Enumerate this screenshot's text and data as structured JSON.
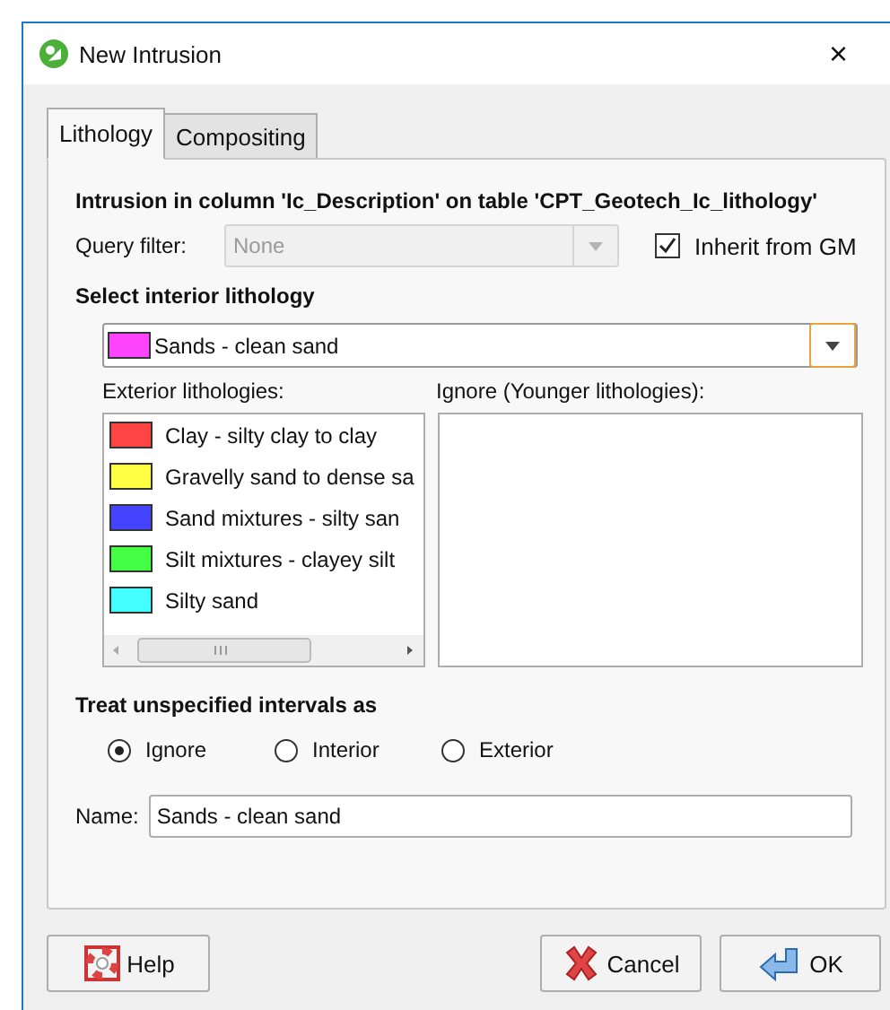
{
  "window": {
    "title": "New Intrusion",
    "close": "×"
  },
  "tabs": [
    {
      "label": "Lithology",
      "selected": true
    },
    {
      "label": "Compositing",
      "selected": false
    }
  ],
  "heading": "Intrusion in column 'Ic_Description' on table 'CPT_Geotech_Ic_lithology'",
  "query_filter": {
    "label": "Query filter:",
    "value": "None",
    "disabled": true
  },
  "inherit": {
    "label": "Inherit from GM",
    "checked": true
  },
  "interior": {
    "label": "Select interior lithology",
    "value": "Sands - clean sand",
    "color": "#ff44ff"
  },
  "exterior": {
    "label": "Exterior lithologies:",
    "items": [
      {
        "name": "Clay - silty clay to clay",
        "color": "#ff4444"
      },
      {
        "name": "Gravelly sand to dense sa",
        "color": "#ffff44"
      },
      {
        "name": "Sand mixtures - silty san",
        "color": "#4444ff"
      },
      {
        "name": "Silt mixtures - clayey silt",
        "color": "#44ff44"
      },
      {
        "name": "Silty sand",
        "color": "#44ffff"
      }
    ]
  },
  "ignore": {
    "label": "Ignore (Younger lithologies):"
  },
  "treat": {
    "label": "Treat unspecified intervals as",
    "options": [
      {
        "label": "Ignore",
        "selected": true
      },
      {
        "label": "Interior",
        "selected": false
      },
      {
        "label": "Exterior",
        "selected": false
      }
    ]
  },
  "name": {
    "label": "Name:",
    "value": "Sands - clean sand"
  },
  "buttons": [
    {
      "kind": "help",
      "label": "Help"
    },
    {
      "kind": "cancel",
      "label": "Cancel"
    },
    {
      "kind": "ok",
      "label": "OK"
    }
  ]
}
